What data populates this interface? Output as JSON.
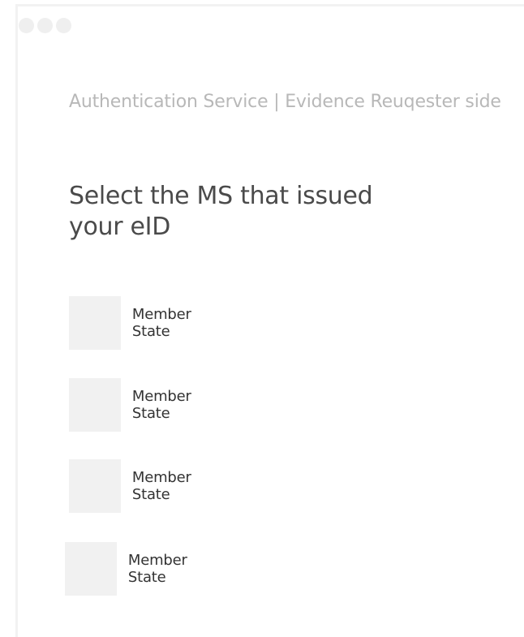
{
  "window": {
    "controls": [
      "window-dot-icon",
      "window-dot-icon",
      "window-dot-icon"
    ]
  },
  "header": {
    "subtitle": "Authentication Service | Evidence Reuqester side",
    "title": "Select the MS that issued your eID"
  },
  "member_states": [
    {
      "label": "Member State",
      "icon": "flag-placeholder"
    },
    {
      "label": "Member State",
      "icon": "flag-placeholder"
    },
    {
      "label": "Member State",
      "icon": "flag-placeholder"
    },
    {
      "label": "Member State",
      "icon": "flag-placeholder"
    }
  ],
  "colors": {
    "placeholder": "#f1f1f1",
    "subtitle": "#b8b8b8",
    "title": "#4a4a4a",
    "label": "#333333"
  }
}
